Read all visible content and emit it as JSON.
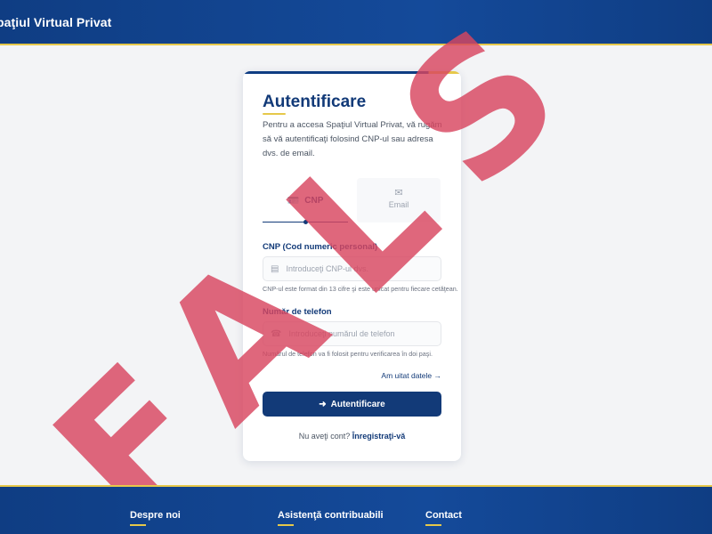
{
  "header": {
    "title": "paţiul Virtual Privat"
  },
  "login": {
    "title": "Autentificare",
    "intro": "Pentru a accesa Spaţiul Virtual Privat, vă rugăm să vă autentificaţi folosind CNP-ul sau adresa dvs. de email.",
    "tabs": [
      {
        "label": "CNP",
        "icon": "id-card-icon",
        "active": true
      },
      {
        "label": "Email",
        "icon": "envelope-icon",
        "active": false
      }
    ],
    "cnp": {
      "label": "CNP (Cod numeric personal)",
      "placeholder": "Introduceţi CNP-ul dvs.",
      "help": "CNP-ul este format din 13 cifre şi este unicat pentru fiecare cetăţean.",
      "icon": "id-card-icon"
    },
    "phone": {
      "label": "Număr de telefon",
      "placeholder": "Introduceţi numărul de telefon",
      "help": "Numărul de telefon va fi folosit pentru verificarea în doi paşi.",
      "icon": "phone-icon"
    },
    "forgot": "Am uitat datele",
    "submit": "Autentificare",
    "register_prompt": "Nu aveţi cont?",
    "register_link": "Înregistraţi-vă"
  },
  "watermark": {
    "text": "FALS",
    "color": "#d8465f"
  },
  "footer": {
    "columns": [
      "Despre noi",
      "Asistenţă contribuabili",
      "Contact"
    ]
  },
  "colors": {
    "brand": "#0f3d83",
    "accent": "#e6c84a",
    "primary_button": "#123a78"
  }
}
